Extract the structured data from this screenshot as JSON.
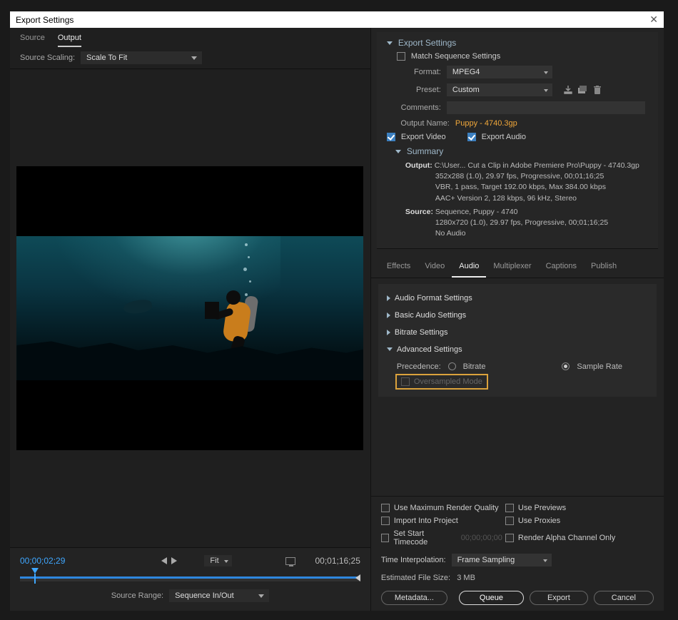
{
  "title": "Export Settings",
  "leftTabs": {
    "source": "Source",
    "output": "Output"
  },
  "sourceScalingLabel": "Source Scaling:",
  "sourceScalingValue": "Scale To Fit",
  "timeline": {
    "current": "00;00;02;29",
    "duration": "00;01;16;25",
    "fit": "Fit"
  },
  "sourceRangeLabel": "Source Range:",
  "sourceRangeValue": "Sequence In/Out",
  "exportSettings": {
    "heading": "Export Settings",
    "matchSeq": "Match Sequence Settings",
    "formatLabel": "Format:",
    "formatValue": "MPEG4",
    "presetLabel": "Preset:",
    "presetValue": "Custom",
    "commentsLabel": "Comments:",
    "outputNameLabel": "Output Name:",
    "outputNameValue": "Puppy - 4740.3gp",
    "exportVideo": "Export Video",
    "exportAudio": "Export Audio",
    "summaryHeading": "Summary",
    "summaryOutputLabel": "Output:",
    "summaryOutputPath": "C:\\User... Cut a Clip in Adobe Premiere Pro\\Puppy - 4740.3gp",
    "summaryOutputLine2": "352x288 (1.0), 29.97 fps, Progressive, 00;01;16;25",
    "summaryOutputLine3": "VBR, 1 pass, Target 192.00 kbps, Max 384.00 kbps",
    "summaryOutputLine4": "AAC+ Version 2, 128 kbps, 96 kHz, Stereo",
    "summarySourceLabel": "Source:",
    "summarySourceLine1": "Sequence, Puppy - 4740",
    "summarySourceLine2": "1280x720 (1.0), 29.97 fps, Progressive, 00;01;16;25",
    "summarySourceLine3": "No Audio"
  },
  "midTabs": {
    "effects": "Effects",
    "video": "Video",
    "audio": "Audio",
    "multiplexer": "Multiplexer",
    "captions": "Captions",
    "publish": "Publish"
  },
  "audioPanel": {
    "audioFormat": "Audio Format Settings",
    "basicAudio": "Basic Audio Settings",
    "bitrate": "Bitrate Settings",
    "advanced": "Advanced Settings",
    "precedenceLabel": "Precedence:",
    "precedenceBitrate": "Bitrate",
    "precedenceSampleRate": "Sample Rate",
    "oversampled": "Oversampled Mode"
  },
  "bottom": {
    "maxRender": "Use Maximum Render Quality",
    "previews": "Use Previews",
    "importProject": "Import Into Project",
    "proxies": "Use Proxies",
    "setStartTC": "Set Start Timecode",
    "startTCValue": "00;00;00;00",
    "renderAlpha": "Render Alpha Channel Only",
    "timeInterpLabel": "Time Interpolation:",
    "timeInterpValue": "Frame Sampling",
    "estLabel": "Estimated File Size:",
    "estValue": "3 MB",
    "metadata": "Metadata...",
    "queue": "Queue",
    "export": "Export",
    "cancel": "Cancel"
  }
}
